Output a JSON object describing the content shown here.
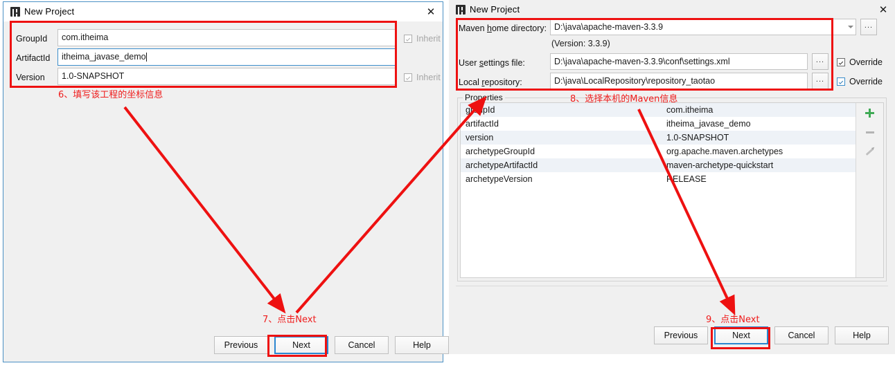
{
  "left_dialog": {
    "title": "New Project",
    "close_icon": "close-icon",
    "app_icon": "intellij-idea-icon",
    "fields": [
      {
        "label": "GroupId",
        "value": "com.itheima",
        "focused": false,
        "inherit_label": "Inherit",
        "inherit_checked": true
      },
      {
        "label": "ArtifactId",
        "value": "itheima_javase_demo",
        "focused": true,
        "inherit_label": "",
        "inherit_checked": false
      },
      {
        "label": "Version",
        "value": "1.0-SNAPSHOT",
        "focused": false,
        "inherit_label": "Inherit",
        "inherit_checked": true
      }
    ],
    "buttons": [
      {
        "label": "Previous",
        "primary": false
      },
      {
        "label": "Next",
        "primary": true
      },
      {
        "label": "Cancel",
        "primary": false
      },
      {
        "label": "Help",
        "primary": false
      }
    ]
  },
  "right_dialog": {
    "title": "New Project",
    "close_icon": "close-icon",
    "app_icon": "intellij-idea-icon",
    "maven_home": {
      "label_pre": "Maven ",
      "label_key": "h",
      "label_post": "ome directory:",
      "value": "D:\\java\\apache-maven-3.3.9",
      "dropdown_icon": "chevron-down-icon",
      "browse_label": "...",
      "version_note": "(Version: 3.3.9)"
    },
    "user_settings": {
      "label_pre": "User ",
      "label_key": "s",
      "label_post": "ettings file:",
      "value": "D:\\java\\apache-maven-3.3.9\\conf\\settings.xml",
      "browse_label": "...",
      "override_label": "Override",
      "override_checked": true,
      "override_style": "dark"
    },
    "local_repository": {
      "label_pre": "Local ",
      "label_key": "r",
      "label_post": "epository:",
      "value": "D:\\java\\LocalRepository\\repository_taotao",
      "browse_label": "...",
      "override_label": "Override",
      "override_checked": true,
      "override_style": "blue"
    },
    "properties": {
      "group_title": "Properties",
      "rows": [
        {
          "key": "groupId",
          "value": "com.itheima"
        },
        {
          "key": "artifactId",
          "value": "itheima_javase_demo"
        },
        {
          "key": "version",
          "value": "1.0-SNAPSHOT"
        },
        {
          "key": "archetypeGroupId",
          "value": "org.apache.maven.archetypes"
        },
        {
          "key": "archetypeArtifactId",
          "value": "maven-archetype-quickstart"
        },
        {
          "key": "archetypeVersion",
          "value": "RELEASE"
        }
      ],
      "tools": [
        {
          "icon": "add-property-icon"
        },
        {
          "icon": "remove-property-icon"
        },
        {
          "icon": "edit-property-icon"
        }
      ]
    },
    "buttons": [
      {
        "label": "Previous",
        "primary": false
      },
      {
        "label": "Next",
        "primary": true
      },
      {
        "label": "Cancel",
        "primary": false
      },
      {
        "label": "Help",
        "primary": false
      }
    ]
  },
  "annotations": {
    "color": "#ef1c1c",
    "notes": [
      {
        "id": "note-6",
        "text": "6、填写该工程的坐标信息"
      },
      {
        "id": "note-7",
        "text": "7、点击Next"
      },
      {
        "id": "note-8",
        "text": "8、选择本机的Maven信息"
      },
      {
        "id": "note-9",
        "text": "9、点击Next"
      }
    ]
  }
}
